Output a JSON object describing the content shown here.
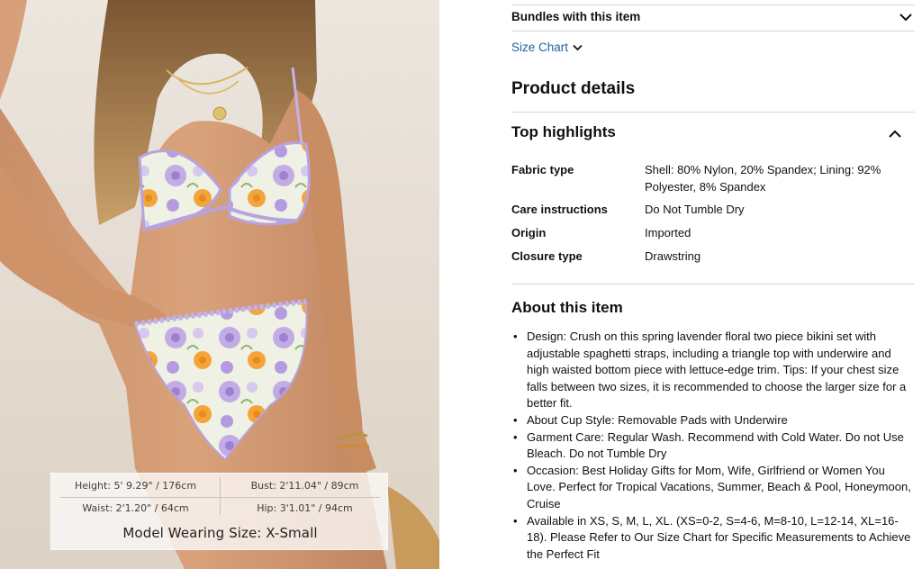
{
  "image": {
    "size_chart": {
      "height": "Height: 5' 9.29\" / 176cm",
      "bust": "Bust: 2'11.04\" / 89cm",
      "waist": "Waist: 2'1.20\" / 64cm",
      "hip": "Hip: 3'1.01\" / 94cm"
    },
    "model_wearing": "Model Wearing Size: X-Small"
  },
  "details": {
    "bundles": "Bundles with this item",
    "size_chart_link": "Size Chart",
    "product_details_title": "Product details",
    "top_highlights_title": "Top highlights",
    "specs": [
      {
        "label": "Fabric type",
        "value": "Shell: 80% Nylon, 20% Spandex; Lining: 92% Polyester, 8% Spandex"
      },
      {
        "label": "Care instructions",
        "value": "Do Not Tumble Dry"
      },
      {
        "label": "Origin",
        "value": "Imported"
      },
      {
        "label": "Closure type",
        "value": "Drawstring"
      }
    ],
    "about_title": "About this item",
    "about_items": [
      "Design: Crush on this spring lavender floral two piece bikini set with adjustable spaghetti straps, including a triangle top with underwire and high waisted bottom piece with lettuce-edge trim. Tips: If your chest size falls between two sizes, it is recommended to choose the larger size for a better fit.",
      "About Cup Style: Removable Pads with Underwire",
      "Garment Care: Regular Wash. Recommend with Cold Water. Do not Use Bleach. Do not Tumble Dry",
      "Occasion: Best Holiday Gifts for Mom, Wife, Girlfriend or Women You Love. Perfect for Tropical Vacations, Summer, Beach & Pool, Honeymoon, Cruise",
      "Available in XS, S, M, L, XL. (XS=0-2, S=4-6, M=8-10, L=12-14, XL=16-18). Please Refer to Our Size Chart for Specific Measurements to Achieve the Perfect Fit"
    ]
  },
  "colors": {
    "link": "#2162a1",
    "text": "#0f1111",
    "divider": "#d5d9d9",
    "lavender": "#b9a3df",
    "floral_orange": "#f3a53b"
  },
  "icons": {
    "bundles_chevron": "chevron-down-icon",
    "size_chart_chevron": "chevron-down-icon",
    "top_highlights_toggle": "chevron-up-icon"
  }
}
